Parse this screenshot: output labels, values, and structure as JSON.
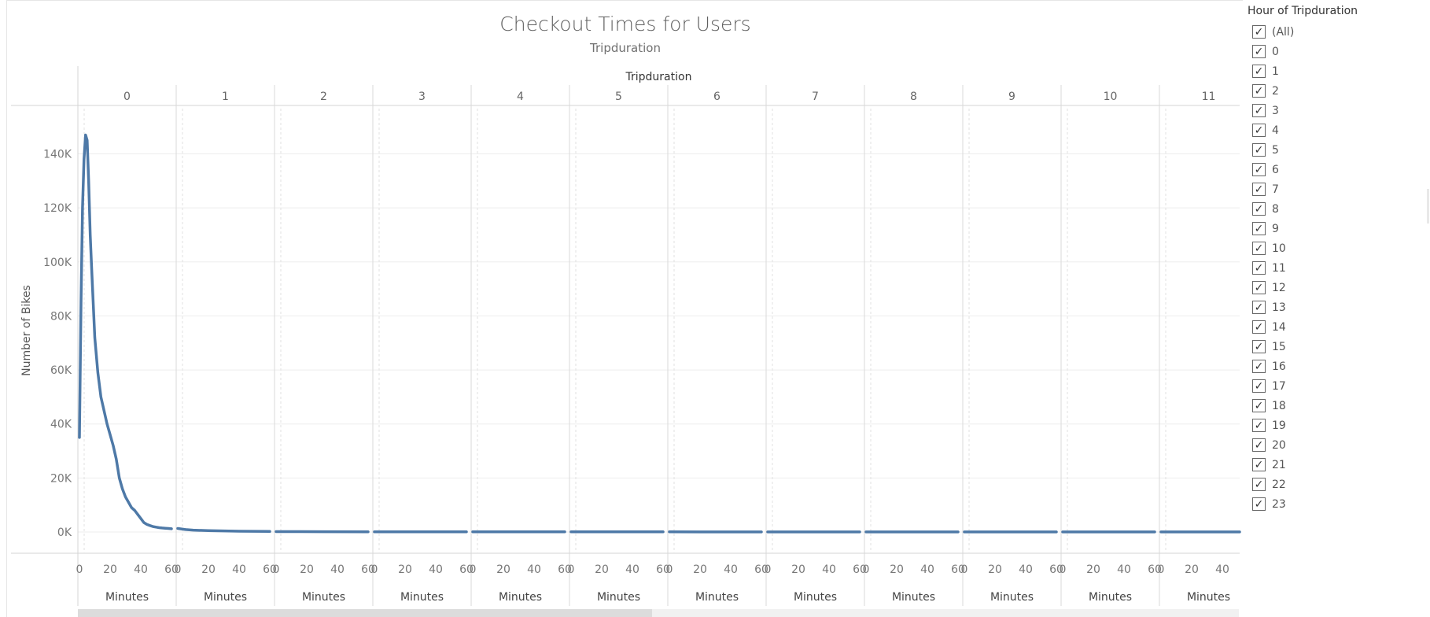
{
  "title": "Checkout Times for Users",
  "subtitle": "Tripduration",
  "column_header": "Tripduration",
  "legend": {
    "title": "Hour of Tripduration",
    "items": [
      "(All)",
      "0",
      "1",
      "2",
      "3",
      "4",
      "5",
      "6",
      "7",
      "8",
      "9",
      "10",
      "11",
      "12",
      "13",
      "14",
      "15",
      "16",
      "17",
      "18",
      "19",
      "20",
      "21",
      "22",
      "23"
    ],
    "checked": true
  },
  "chart_data": {
    "type": "line",
    "title": "Checkout Times for Users",
    "subtitle": "Tripduration",
    "ylabel": "Number of Bikes",
    "xlabel": "Minutes",
    "ylim": [
      0,
      155000
    ],
    "yticks": [
      0,
      20000,
      40000,
      60000,
      80000,
      100000,
      120000,
      140000
    ],
    "ytick_labels": [
      "0K",
      "20K",
      "40K",
      "60K",
      "80K",
      "100K",
      "120K",
      "140K"
    ],
    "xlim": [
      0,
      60
    ],
    "xticks": [
      0,
      20,
      40,
      60
    ],
    "panels": [
      "0",
      "1",
      "2",
      "3",
      "4",
      "5",
      "6",
      "7",
      "8",
      "9",
      "10",
      "11"
    ],
    "color": "#4e79a7",
    "series": [
      {
        "panel": "0",
        "x": [
          0,
          1,
          2,
          3,
          4,
          5,
          6,
          7,
          8,
          10,
          12,
          14,
          16,
          18,
          20,
          22,
          24,
          26,
          28,
          30,
          32,
          34,
          36,
          38,
          40,
          42,
          44,
          46,
          48,
          50,
          52,
          54,
          56,
          58,
          60
        ],
        "y": [
          35000,
          85000,
          120000,
          138000,
          147000,
          145000,
          130000,
          110000,
          97000,
          72000,
          59000,
          50000,
          45000,
          40000,
          36000,
          32000,
          27000,
          20000,
          16000,
          13000,
          11000,
          9000,
          8000,
          6500,
          5000,
          3500,
          2800,
          2400,
          2000,
          1800,
          1600,
          1500,
          1400,
          1300,
          1200
        ]
      },
      {
        "panel": "1",
        "x": [
          0,
          5,
          10,
          20,
          30,
          40,
          50,
          60
        ],
        "y": [
          1300,
          900,
          700,
          500,
          400,
          300,
          250,
          200
        ]
      },
      {
        "panel": "2",
        "x": [
          0,
          30,
          60
        ],
        "y": [
          150,
          120,
          100
        ]
      },
      {
        "panel": "3",
        "x": [
          0,
          30,
          60
        ],
        "y": [
          100,
          90,
          80
        ]
      },
      {
        "panel": "4",
        "x": [
          0,
          30,
          60
        ],
        "y": [
          80,
          70,
          60
        ]
      },
      {
        "panel": "5",
        "x": [
          0,
          30,
          60
        ],
        "y": [
          60,
          50,
          50
        ]
      },
      {
        "panel": "6",
        "x": [
          0,
          30,
          60
        ],
        "y": [
          50,
          40,
          40
        ]
      },
      {
        "panel": "7",
        "x": [
          0,
          30,
          60
        ],
        "y": [
          40,
          30,
          30
        ]
      },
      {
        "panel": "8",
        "x": [
          0,
          30,
          60
        ],
        "y": [
          30,
          30,
          30
        ]
      },
      {
        "panel": "9",
        "x": [
          0,
          30,
          60
        ],
        "y": [
          30,
          20,
          20
        ]
      },
      {
        "panel": "10",
        "x": [
          0,
          30,
          60
        ],
        "y": [
          20,
          20,
          20
        ]
      },
      {
        "panel": "11",
        "x": [
          0,
          30,
          60
        ],
        "y": [
          20,
          20,
          20
        ]
      }
    ]
  }
}
